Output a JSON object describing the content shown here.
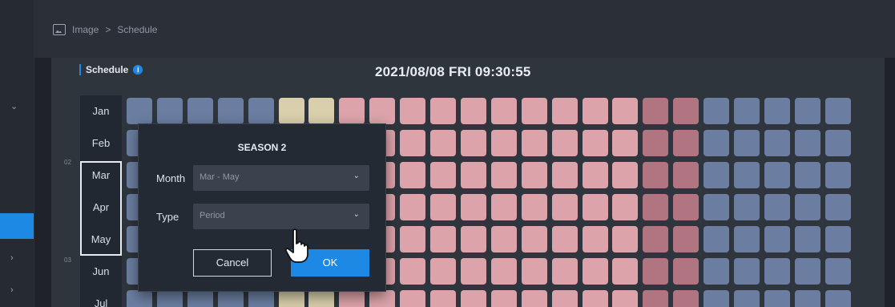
{
  "breadcrumb": {
    "parent": "Image",
    "separator": ">",
    "current": "Schedule"
  },
  "schedule": {
    "title": "Schedule",
    "datetime": "2021/08/08 FRI 09:30:55"
  },
  "months": [
    "Jan",
    "Feb",
    "Mar",
    "Apr",
    "May",
    "Jun",
    "Jul"
  ],
  "row_numbers": [
    "02",
    "03"
  ],
  "grid": {
    "palette": {
      "blue": "#6b7ea1",
      "beige": "#d9cfac",
      "pink_light": "#e6b3b8",
      "pink": "#dca3aa",
      "pink_dark": "#b07580"
    },
    "rows": [
      [
        "blue",
        "blue",
        "blue",
        "blue",
        "blue",
        "beige",
        "beige",
        "pink",
        "pink",
        "pink",
        "pink",
        "pink",
        "pink",
        "pink",
        "pink",
        "pink",
        "pink",
        "pink_dark",
        "pink_dark",
        "blue",
        "blue",
        "blue",
        "blue",
        "blue"
      ],
      [
        "blue",
        "blue",
        "blue",
        "blue",
        "blue",
        "beige",
        "beige",
        "pink",
        "pink",
        "pink",
        "pink",
        "pink",
        "pink",
        "pink",
        "pink",
        "pink",
        "pink",
        "pink_dark",
        "pink_dark",
        "blue",
        "blue",
        "blue",
        "blue",
        "blue"
      ],
      [
        "blue",
        "blue",
        "blue",
        "blue",
        "blue",
        "beige",
        "beige",
        "pink",
        "pink",
        "pink",
        "pink",
        "pink",
        "pink",
        "pink",
        "pink",
        "pink",
        "pink",
        "pink_dark",
        "pink_dark",
        "blue",
        "blue",
        "blue",
        "blue",
        "blue"
      ],
      [
        "blue",
        "blue",
        "blue",
        "blue",
        "blue",
        "beige",
        "beige",
        "pink",
        "pink",
        "pink",
        "pink",
        "pink",
        "pink",
        "pink",
        "pink",
        "pink",
        "pink",
        "pink_dark",
        "pink_dark",
        "blue",
        "blue",
        "blue",
        "blue",
        "blue"
      ],
      [
        "blue",
        "blue",
        "blue",
        "blue",
        "blue",
        "beige",
        "beige",
        "pink",
        "pink",
        "pink",
        "pink",
        "pink",
        "pink",
        "pink",
        "pink",
        "pink",
        "pink",
        "pink_dark",
        "pink_dark",
        "blue",
        "blue",
        "blue",
        "blue",
        "blue"
      ],
      [
        "blue",
        "blue",
        "blue",
        "blue",
        "blue",
        "beige",
        "beige",
        "pink",
        "pink",
        "pink",
        "pink",
        "pink",
        "pink",
        "pink",
        "pink",
        "pink",
        "pink",
        "pink_dark",
        "pink_dark",
        "blue",
        "blue",
        "blue",
        "blue",
        "blue"
      ],
      [
        "blue",
        "blue",
        "blue",
        "blue",
        "blue",
        "beige",
        "beige",
        "pink",
        "pink",
        "pink",
        "pink",
        "pink",
        "pink",
        "pink",
        "pink",
        "pink",
        "pink",
        "pink_dark",
        "pink_dark",
        "blue",
        "blue",
        "blue",
        "blue",
        "blue"
      ]
    ]
  },
  "dialog": {
    "title": "SEASON 2",
    "month_label": "Month",
    "month_value": "Mar  -  May",
    "type_label": "Type",
    "type_value": "Period",
    "cancel_label": "Cancel",
    "ok_label": "OK"
  },
  "colors": {
    "accent": "#1e88e5",
    "background": "#1f2329",
    "panel": "#2f353d"
  }
}
